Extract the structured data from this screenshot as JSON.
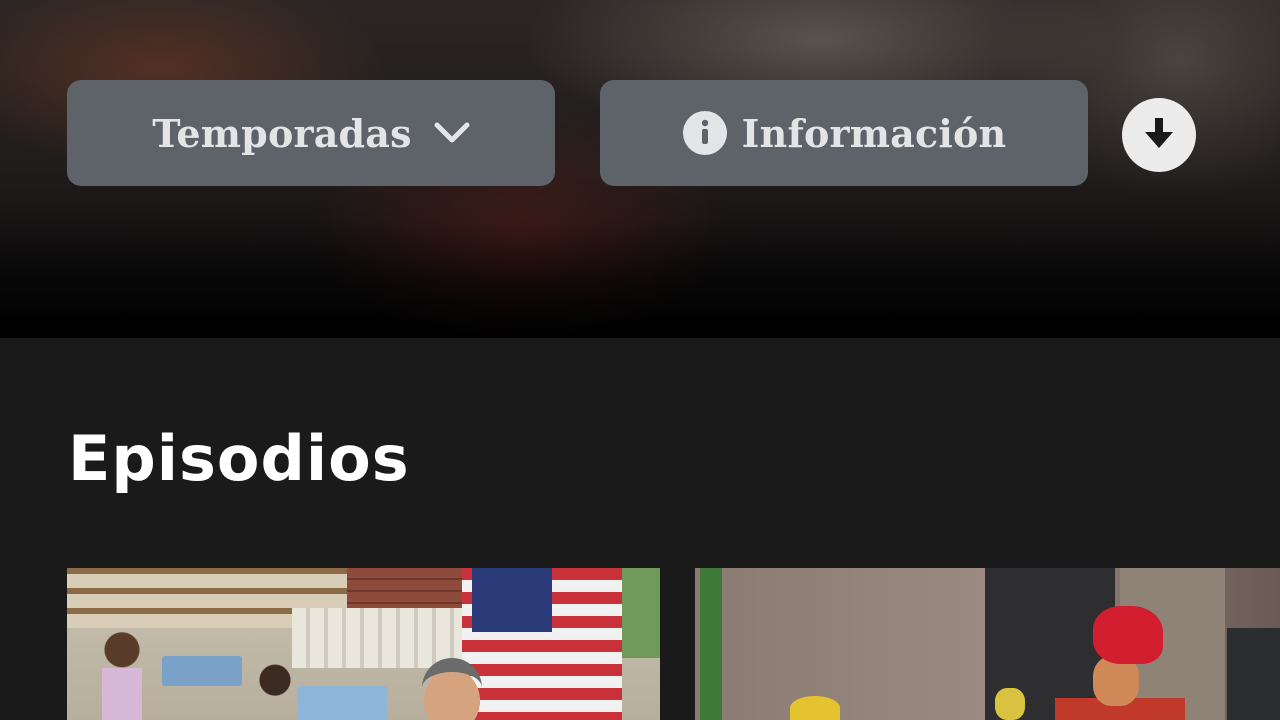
{
  "hero": {
    "seasons_label": "Temporadas",
    "info_label": "Información"
  },
  "icons": {
    "seasons_chevron": "chevron-down-icon",
    "info": "info-icon",
    "download": "download-icon"
  },
  "section": {
    "title": "Episodios"
  },
  "colors": {
    "button_bg": "#5e636a",
    "page_bg": "#1a1a1a",
    "title_text": "#ffffff"
  }
}
